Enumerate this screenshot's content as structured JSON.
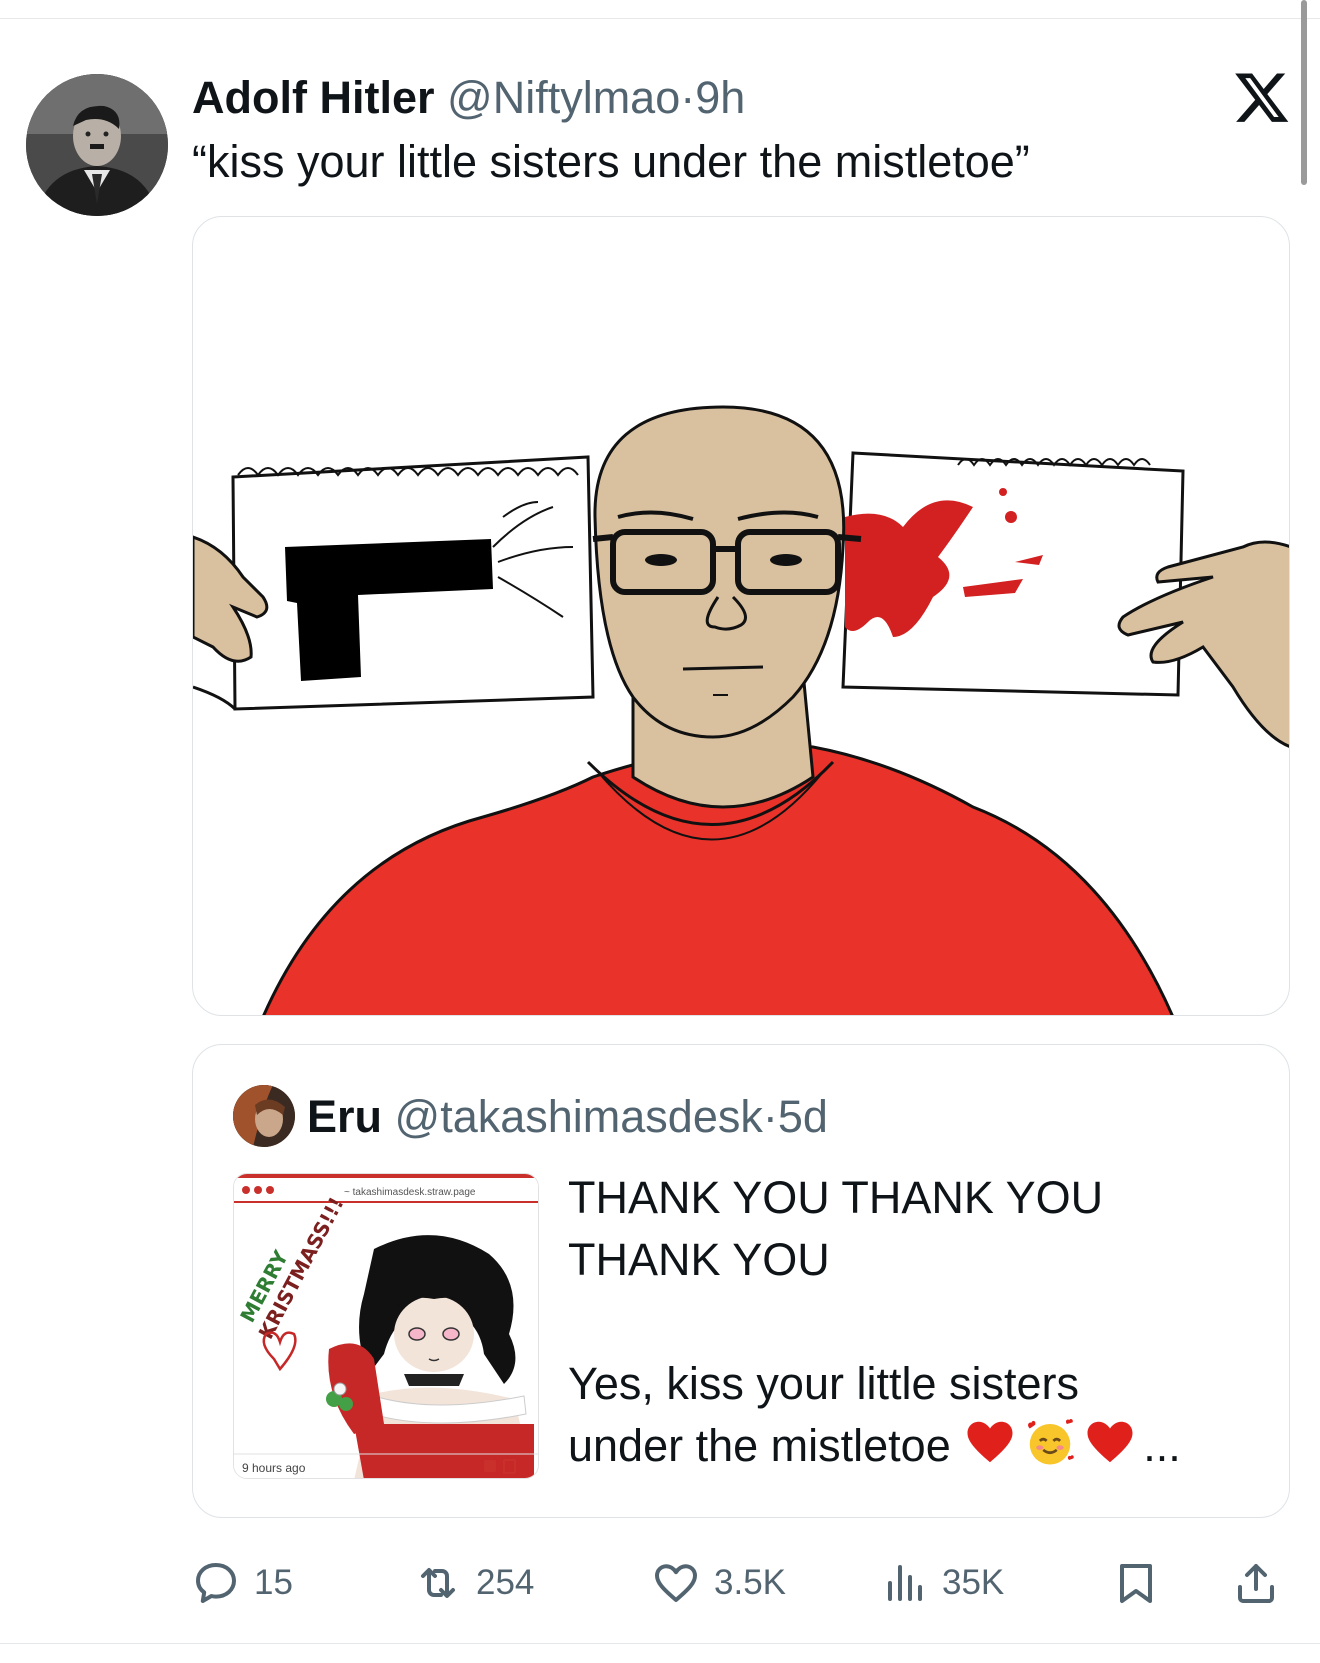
{
  "post": {
    "author_name": "Adolf Hitler",
    "handle": "@Niftylmao",
    "separator": "·",
    "time": "9h",
    "text": "“kiss your little sisters under the mistletoe”"
  },
  "quote": {
    "author_name": "Eru",
    "handle": "@takashimasdesk",
    "separator": "·",
    "time": "5d",
    "lines": [
      "THANK YOU THANK YOU",
      "THANK YOU",
      "Yes, kiss your little sisters",
      "under the mistletoe"
    ],
    "ellipsis": "...",
    "emojis": [
      "red-heart",
      "smiling-face-with-hearts",
      "red-heart"
    ],
    "thumbnail": {
      "url_text": "~ takashimasdesk.straw.page",
      "caption_line1": "MERRY",
      "caption_line2": "KRISTMASS!!!",
      "footer": "9 hours ago"
    }
  },
  "actions": {
    "replies": "15",
    "reposts": "254",
    "likes": "3.5K",
    "views": "35K"
  },
  "colors": {
    "text": "#0f1419",
    "muted": "#536471",
    "border": "#dfe3e6",
    "sweater_red": "#e8322a",
    "skin": "#d9c1a0"
  },
  "icons": {
    "brand": "x-logo",
    "reply": "comment-icon",
    "repost": "repost-icon",
    "like": "heart-icon",
    "views": "views-chart-icon",
    "bookmark": "bookmark-icon",
    "share": "share-icon"
  }
}
